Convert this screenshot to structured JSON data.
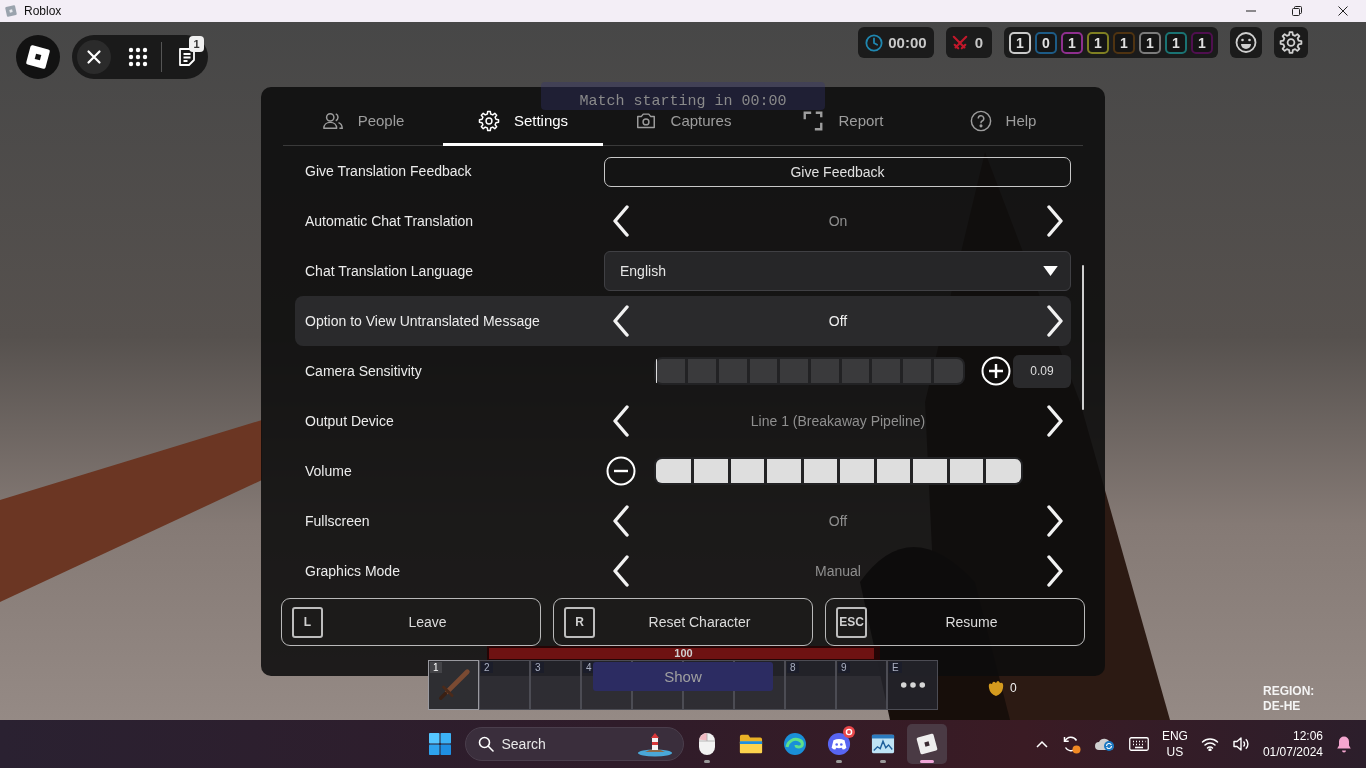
{
  "window": {
    "title": "Roblox"
  },
  "hud": {
    "unread_count": "1",
    "timer": "00:00",
    "kills": "0",
    "team_scores": [
      {
        "value": "1",
        "color": "#c9c9c9"
      },
      {
        "value": "0",
        "color": "#1d5b86"
      },
      {
        "value": "1",
        "color": "#8e2f8e"
      },
      {
        "value": "1",
        "color": "#7f7f22"
      },
      {
        "value": "1",
        "color": "#4f3311"
      },
      {
        "value": "1",
        "color": "#7b7b7b"
      },
      {
        "value": "1",
        "color": "#1a7373"
      },
      {
        "value": "1",
        "color": "#4f0f4f"
      }
    ],
    "match_banner": "Match starting in 00:00",
    "health": {
      "level": 1,
      "text": "100"
    },
    "show_button": "Show",
    "coins": "0",
    "region": {
      "label": "REGION:",
      "value": "DE-HE"
    }
  },
  "hotbar": [
    {
      "number": "1",
      "kind": "sword"
    },
    {
      "number": "2",
      "kind": "empty"
    },
    {
      "number": "3",
      "kind": "empty"
    },
    {
      "number": "4",
      "kind": "empty"
    },
    {
      "kind": "empty"
    },
    {
      "kind": "empty"
    },
    {
      "kind": "empty"
    },
    {
      "number": "8",
      "kind": "empty"
    },
    {
      "number": "9",
      "kind": "empty"
    },
    {
      "number": "E",
      "kind": "more"
    }
  ],
  "menu": {
    "tabs": [
      {
        "label": "People",
        "selected": false
      },
      {
        "label": "Settings",
        "selected": true
      },
      {
        "label": "Captures",
        "selected": false
      },
      {
        "label": "Report",
        "selected": false
      },
      {
        "label": "Help",
        "selected": false
      }
    ],
    "rows": [
      {
        "kind": "button",
        "label": "Give Translation Feedback",
        "button": "Give Feedback",
        "selected": false
      },
      {
        "kind": "selector",
        "label": "Automatic Chat Translation",
        "value": "On",
        "selected": false
      },
      {
        "kind": "dropdown",
        "label": "Chat Translation Language",
        "value": "English",
        "selected": false
      },
      {
        "kind": "selector",
        "label": "Option to View Untranslated Message",
        "value": "Off",
        "selected": true
      },
      {
        "kind": "slider",
        "label": "Camera Sensitivity",
        "level": 0,
        "decrease_button": false,
        "increase_button": true,
        "value": "0.09",
        "selected": false
      },
      {
        "kind": "selector",
        "label": "Output Device",
        "value": "Line 1 (Breakaway Pipeline)",
        "selected": false
      },
      {
        "kind": "slider",
        "label": "Volume",
        "level": 1,
        "decrease_button": true,
        "increase_button": false,
        "selected": false
      },
      {
        "kind": "selector",
        "label": "Fullscreen",
        "value": "Off",
        "selected": false
      },
      {
        "kind": "selector",
        "label": "Graphics Mode",
        "value": "Manual",
        "selected": false
      }
    ],
    "buttons": [
      {
        "key": "L",
        "label": "Leave"
      },
      {
        "key": "R",
        "label": "Reset Character"
      },
      {
        "key": "ESC",
        "label": "Resume"
      }
    ]
  },
  "taskbar": {
    "search": {
      "placeholder": "Search"
    },
    "apps": [
      {
        "running": true,
        "selected": false,
        "notification": false
      },
      {
        "running": false,
        "selected": false,
        "notification": false
      },
      {
        "running": false,
        "selected": false,
        "notification": false
      },
      {
        "running": true,
        "selected": false,
        "notification": true
      },
      {
        "running": true,
        "selected": false,
        "notification": false
      },
      {
        "running": true,
        "selected": true,
        "notification": false
      }
    ],
    "language": "ENG",
    "layout": "US",
    "time": "12:06",
    "date": "01/07/2024"
  }
}
